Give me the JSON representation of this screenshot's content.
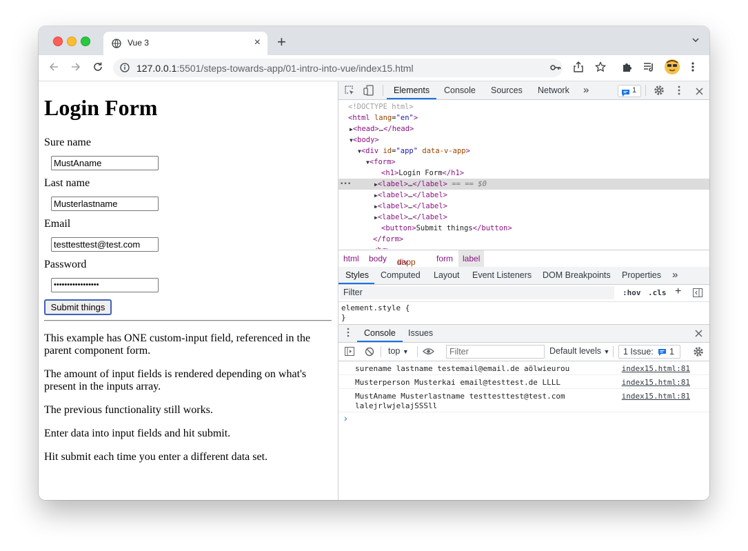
{
  "browser": {
    "tab_title": "Vue 3",
    "url_host": "127.0.0.1",
    "url_rest": ":5501/steps-towards-app/01-intro-into-vue/index15.html"
  },
  "page": {
    "heading": "Login Form",
    "fields": [
      {
        "label": "Sure name",
        "value": "MustAname"
      },
      {
        "label": "Last name",
        "value": "Musterlastname"
      },
      {
        "label": "Email",
        "value": "testtesttest@test.com"
      },
      {
        "label": "Password",
        "value": "•••••••••••••••••"
      }
    ],
    "submit_label": "Submit things",
    "paragraphs": [
      "This example has ONE custom-input field, referenced in the parent component form.",
      "The amount of input fields is rendered depending on what's present in the inputs array.",
      "The previous functionality still works.",
      "Enter data into input fields and hit submit.",
      "Hit submit each time you enter a different data set."
    ]
  },
  "devtools": {
    "tabs": [
      "Elements",
      "Console",
      "Sources",
      "Network"
    ],
    "more": "»",
    "issues_badge": "1",
    "dom_comment": "<!DOCTYPE html>",
    "dom_h1_text": "Login Form",
    "dom_button_text": "Submit things",
    "selected_suffix": "== $0",
    "breadcrumb": [
      "html",
      "body",
      "div",
      "#app",
      "form",
      "label"
    ],
    "style_tabs": [
      "Styles",
      "Computed",
      "Layout",
      "Event Listeners",
      "DOM Breakpoints",
      "Properties"
    ],
    "filter_placeholder": "Filter",
    "hov": ":hov",
    "cls": ".cls",
    "element_style_open": "element.style {",
    "element_style_close": "}",
    "drawer_tabs": [
      "Console",
      "Issues"
    ],
    "console_context": "top",
    "console_filter_placeholder": "Filter",
    "levels": "Default levels",
    "issues_label": "1 Issue:",
    "issues_count": "1",
    "messages": [
      {
        "text": "surename lastname testemail@email.de aölwieurou",
        "source": "index15.html:81"
      },
      {
        "text": "Musterperson Musterkai email@testtest.de LLLL",
        "source": "index15.html:81"
      },
      {
        "text": "MustAname Musterlastname testtesttest@test.com lalejrlwjelajSSSll",
        "source": "index15.html:81"
      }
    ],
    "prompt": "›"
  }
}
